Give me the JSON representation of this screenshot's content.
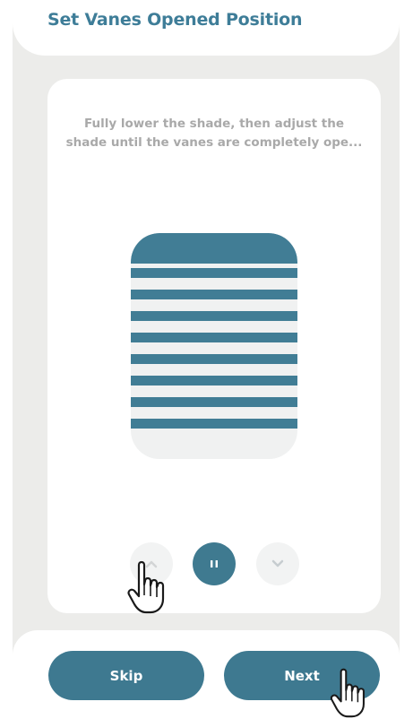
{
  "header": {
    "title": "Set Vanes Opened Position"
  },
  "card": {
    "instruction": "Fully lower the shade, then adjust the shade until the vanes are completely ope..."
  },
  "controls": {
    "up_icon": "chevron-up-icon",
    "pause_icon": "pause-icon",
    "down_icon": "chevron-down-icon"
  },
  "actions": {
    "skip_label": "Skip",
    "next_label": "Next"
  },
  "colors": {
    "accent": "#3e7d98",
    "button": "#3e7990",
    "background": "#ececea",
    "vane": "#417d95",
    "instruction_text": "#a9a9a9"
  }
}
